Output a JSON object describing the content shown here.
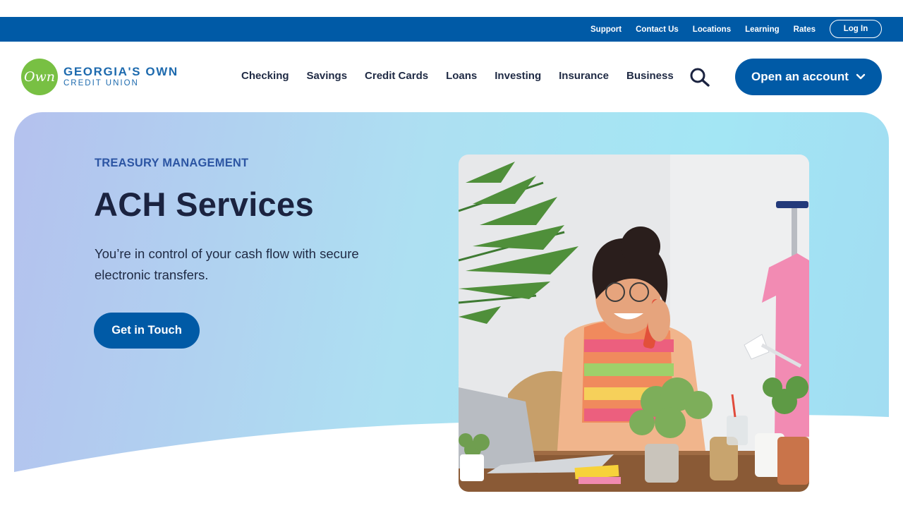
{
  "utility": {
    "links": [
      "Support",
      "Contact Us",
      "Locations",
      "Learning",
      "Rates"
    ],
    "login": "Log In"
  },
  "brand": {
    "logo_mark": "Own",
    "name_line1": "GEORGIA'S OWN",
    "name_line2": "CREDIT UNION"
  },
  "nav": {
    "items": [
      "Checking",
      "Savings",
      "Credit Cards",
      "Loans",
      "Investing",
      "Insurance",
      "Business"
    ],
    "search_icon": "search-icon",
    "open_account": "Open an account",
    "open_account_icon": "chevron-down-icon"
  },
  "hero": {
    "eyebrow": "TREASURY MANAGEMENT",
    "title": "ACH Services",
    "subtitle": "You’re in control of your cash flow with secure electronic transfers.",
    "cta": "Get in Touch"
  },
  "colors": {
    "brand_blue": "#005aa6",
    "logo_green": "#78c043",
    "heading_navy": "#1b2340",
    "eyebrow_blue": "#2c55a3"
  }
}
